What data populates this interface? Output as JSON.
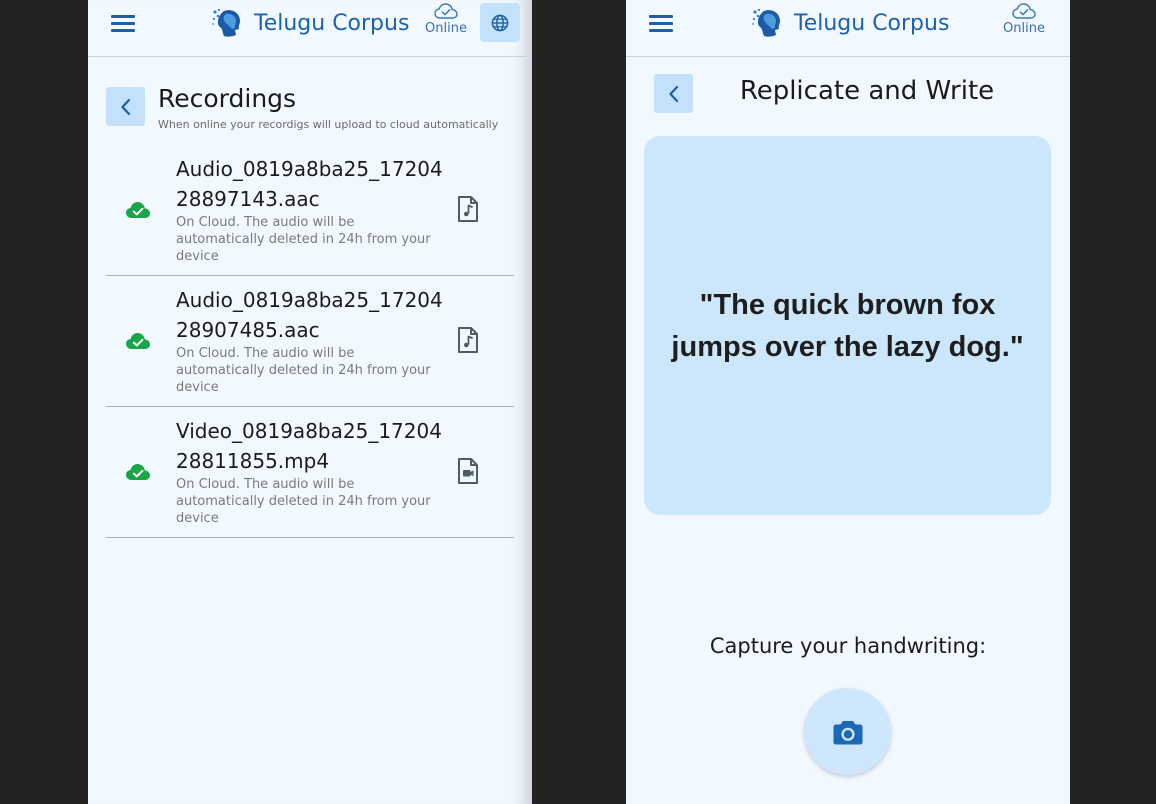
{
  "app": {
    "title": "Telugu Corpus",
    "status_label": "Online"
  },
  "recordings_screen": {
    "title": "Recordings",
    "subtitle": "When online your recordigs will upload to cloud automatically",
    "items": [
      {
        "name": "Audio_0819a8ba25_1720428897143.aac",
        "description": "On Cloud. The audio will be automatically deleted in 24h from your device",
        "status_icon": "cloud-check-icon",
        "file_icon": "audio-file-icon"
      },
      {
        "name": "Audio_0819a8ba25_1720428907485.aac",
        "description": "On Cloud. The audio will be automatically deleted in 24h from your device",
        "status_icon": "cloud-check-icon",
        "file_icon": "audio-file-icon"
      },
      {
        "name": "Video_0819a8ba25_1720428811855.mp4",
        "description": "On Cloud. The audio will be automatically deleted in 24h from your device",
        "status_icon": "cloud-check-icon",
        "file_icon": "video-file-icon"
      }
    ]
  },
  "replicate_screen": {
    "title": "Replicate and Write",
    "quote": "\"The quick brown fox jumps over the lazy dog.\"",
    "capture_label": "Capture your handwriting:"
  },
  "colors": {
    "accent": "#1d62ad",
    "button_bg": "#c4e1fb",
    "card_bg": "#cce6fb",
    "success": "#18a648",
    "screen_bg": "#f2f8ff",
    "backdrop": "#232323"
  },
  "icons": {
    "menu": "menu-icon",
    "status": "cloud-check-icon",
    "language": "globe-icon",
    "back": "chevron-left-icon",
    "camera": "camera-icon"
  }
}
